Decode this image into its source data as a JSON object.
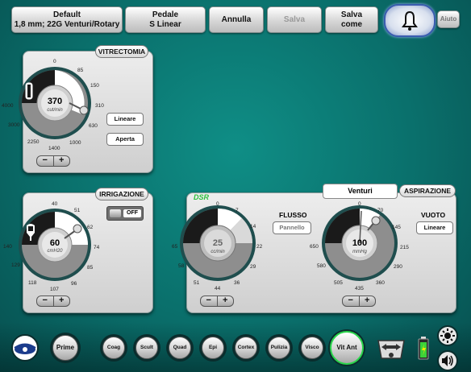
{
  "top": {
    "default_line1": "Default",
    "default_line2": "1,8 mm; 22G Venturi/Rotary",
    "pedal_line1": "Pedale",
    "pedal_line2": "S Linear",
    "annulla": "Annulla",
    "salva": "Salva",
    "salva_come_1": "Salva",
    "salva_come_2": "come",
    "aiuto": "Aiuto"
  },
  "vitrectomia": {
    "title": "VITRECTOMIA",
    "value": "370",
    "unit": "cut/min",
    "ticks": [
      "0",
      "150",
      "310",
      "630",
      "1000",
      "1400",
      "2250",
      "3000",
      "4000",
      "85"
    ],
    "btn_lineare": "Lineare",
    "btn_aperta": "Aperta"
  },
  "irrigazione": {
    "title": "IRRIGAZIONE",
    "toggle": "OFF",
    "value": "60",
    "unit": "cmH20",
    "ticks": [
      "40",
      "51",
      "62",
      "74",
      "85",
      "96",
      "107",
      "118",
      "129",
      "140"
    ]
  },
  "aspirazione": {
    "tab_venturi": "Venturi",
    "tab_aspirazione": "ASPIRAZIONE",
    "dsr": "DSR",
    "flusso_label": "FLUSSO",
    "flusso_btn": "Pannello",
    "vuoto_label": "VUOTO",
    "vuoto_btn": "Lineare",
    "flow_value": "25",
    "flow_unit": "cc/min",
    "flow_ticks": [
      "0",
      "7",
      "14",
      "22",
      "29",
      "36",
      "44",
      "51",
      "58",
      "65"
    ],
    "vac_value": "100",
    "vac_unit": "mmHg",
    "vac_ticks": [
      "0",
      "70",
      "145",
      "215",
      "290",
      "360",
      "435",
      "505",
      "580",
      "650"
    ]
  },
  "bottom": {
    "prime": "Prime",
    "coag": "Coag",
    "scult": "Scult",
    "quad": "Quad",
    "epi": "Epi",
    "cortex": "Cortex",
    "pulizia": "Pulizia",
    "visco": "Visco",
    "vitant": "Vit Ant"
  },
  "pm": {
    "minus": "−",
    "plus": "+"
  },
  "colors": {
    "teal": "#0a7a74",
    "gauge_ring": "#1e4a4a",
    "dsr_green": "#2cbf3c"
  }
}
